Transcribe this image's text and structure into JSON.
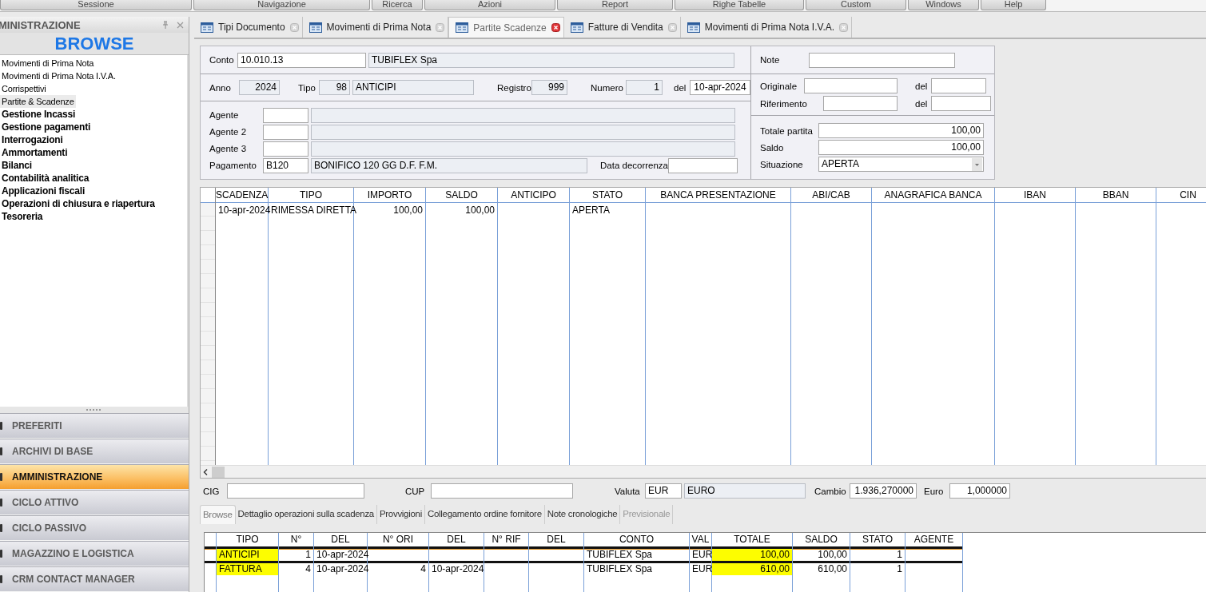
{
  "menu": [
    "Sessione",
    "Navigazione",
    "Ricerca",
    "Azioni",
    "Report",
    "Righe Tabelle",
    "Custom",
    "Windows",
    "Help"
  ],
  "sidebar": {
    "title": "MINISTRAZIONE",
    "heading": "BROWSE",
    "items": [
      {
        "label": "Movimenti di Prima Nota",
        "kind": "item",
        "selected": false
      },
      {
        "label": "Movimenti di Prima Nota I.V.A.",
        "kind": "item",
        "selected": false
      },
      {
        "label": "Corrispettivi",
        "kind": "item",
        "selected": false
      },
      {
        "label": "Partite & Scadenze",
        "kind": "item",
        "selected": true
      },
      {
        "label": "Gestione Incassi",
        "kind": "group",
        "selected": false
      },
      {
        "label": "Gestione pagamenti",
        "kind": "group",
        "selected": false
      },
      {
        "label": "Interrogazioni",
        "kind": "group",
        "selected": false
      },
      {
        "label": "Ammortamenti",
        "kind": "group",
        "selected": false
      },
      {
        "label": "Bilanci",
        "kind": "group",
        "selected": false
      },
      {
        "label": "Contabilità analitica",
        "kind": "group",
        "selected": false
      },
      {
        "label": "Applicazioni fiscali",
        "kind": "group",
        "selected": false
      },
      {
        "label": "Operazioni di chiusura e riapertura",
        "kind": "group",
        "selected": false
      },
      {
        "label": "Tesoreria",
        "kind": "group",
        "selected": false
      }
    ],
    "sections": [
      {
        "label": "PREFERITI",
        "selected": false
      },
      {
        "label": "ARCHIVI DI BASE",
        "selected": false
      },
      {
        "label": "AMMINISTRAZIONE",
        "selected": true
      },
      {
        "label": "CICLO ATTIVO",
        "selected": false
      },
      {
        "label": "CICLO PASSIVO",
        "selected": false
      },
      {
        "label": "MAGAZZINO E LOGISTICA",
        "selected": false
      },
      {
        "label": "CRM CONTACT MANAGER",
        "selected": false
      }
    ]
  },
  "tabs": [
    {
      "label": "Tipi Documento",
      "selected": false
    },
    {
      "label": "Movimenti di Prima Nota",
      "selected": false
    },
    {
      "label": "Partite  Scadenze",
      "selected": true
    },
    {
      "label": "Fatture di Vendita",
      "selected": false
    },
    {
      "label": "Movimenti di Prima Nota I.V.A.",
      "selected": false
    }
  ],
  "form": {
    "conto": {
      "label": "Conto",
      "code": "10.010.13",
      "name": "TUBIFLEX Spa"
    },
    "note": {
      "label": "Note"
    },
    "anno": {
      "label": "Anno",
      "value": "2024"
    },
    "tipo": {
      "label": "Tipo",
      "code": "98",
      "name": "ANTICIPI"
    },
    "registro": {
      "label": "Registro",
      "value": "999"
    },
    "numero": {
      "label": "Numero",
      "value": "1"
    },
    "data": {
      "label": "del",
      "value": "10-apr-2024"
    },
    "originale": {
      "label": "Originale",
      "del_label": "del"
    },
    "riferimento": {
      "label": "Riferimento",
      "del_label": "del"
    },
    "agenti": [
      {
        "label": "Agente"
      },
      {
        "label": "Agente 2"
      },
      {
        "label": "Agente 3"
      }
    ],
    "pagamento": {
      "label": "Pagamento",
      "code": "B120",
      "name": "BONIFICO 120 GG D.F. F.M."
    },
    "data_decorrenza": {
      "label": "Data decorrenza"
    },
    "totale_partita": {
      "label": "Totale partita",
      "value": "100,00"
    },
    "saldo": {
      "label": "Saldo",
      "value": "100,00"
    },
    "situazione": {
      "label": "Situazione",
      "value": "APERTA"
    }
  },
  "grid": {
    "columns": [
      "SCADENZA",
      "TIPO",
      "IMPORTO",
      "SALDO",
      "ANTICIPO",
      "STATO",
      "BANCA PRESENTAZIONE",
      "ABI/CAB",
      "ANAGRAFICA BANCA",
      "IBAN",
      "BBAN",
      "CIN"
    ],
    "rows": [
      {
        "cells": [
          "10-apr-2024",
          "RIMESSA DIRETTA",
          "100,00",
          "100,00",
          null,
          "APERTA",
          null,
          null,
          null,
          null,
          null,
          null
        ]
      }
    ]
  },
  "extra": {
    "cig": {
      "label": "CIG"
    },
    "cup": {
      "label": "CUP"
    },
    "valuta": {
      "label": "Valuta",
      "code": "EUR",
      "name": "EURO"
    },
    "cambio": {
      "label": "Cambio",
      "value": "1.936,270000"
    },
    "euro": {
      "label": "Euro",
      "value": "1,000000"
    }
  },
  "subtabs": [
    {
      "label": "Browse",
      "selected": true,
      "disabled": false
    },
    {
      "label": "Dettaglio operazioni sulla scadenza",
      "selected": false,
      "disabled": false
    },
    {
      "label": "Provvigioni",
      "selected": false,
      "disabled": false
    },
    {
      "label": "Collegamento ordine fornitore",
      "selected": false,
      "disabled": false
    },
    {
      "label": "Note cronologiche",
      "selected": false,
      "disabled": false
    },
    {
      "label": "Previsionale",
      "selected": false,
      "disabled": true
    }
  ],
  "lower_grid": {
    "columns": [
      "TIPO",
      "N°",
      "DEL",
      "N° ORI",
      "DEL",
      "N° RIF",
      "DEL",
      "CONTO",
      "VAL",
      "TOTALE",
      "SALDO",
      "STATO",
      "AGENTE"
    ],
    "rows": [
      {
        "cells": [
          {
            "text": "ANTICIPI",
            "highlighted": true
          },
          {
            "text": "1",
            "highlighted": false
          },
          {
            "text": "10-apr-2024",
            "highlighted": false
          },
          null,
          null,
          null,
          null,
          {
            "text": "TUBIFLEX Spa",
            "highlighted": false
          },
          {
            "text": "EUR",
            "highlighted": false
          },
          {
            "text": "100,00",
            "highlighted": true
          },
          {
            "text": "100,00",
            "highlighted": false
          },
          {
            "text": "1",
            "highlighted": false
          },
          null
        ]
      },
      {
        "cells": [
          {
            "text": "FATTURA",
            "highlighted": true
          },
          {
            "text": "4",
            "highlighted": false
          },
          {
            "text": "10-apr-2024",
            "highlighted": false
          },
          {
            "text": "4",
            "highlighted": false
          },
          {
            "text": "10-apr-2024",
            "highlighted": false
          },
          null,
          null,
          {
            "text": "TUBIFLEX Spa",
            "highlighted": false
          },
          {
            "text": "EUR",
            "highlighted": false
          },
          {
            "text": "610,00",
            "highlighted": true
          },
          {
            "text": "610,00",
            "highlighted": false
          },
          {
            "text": "1",
            "highlighted": false
          },
          null
        ]
      }
    ]
  }
}
